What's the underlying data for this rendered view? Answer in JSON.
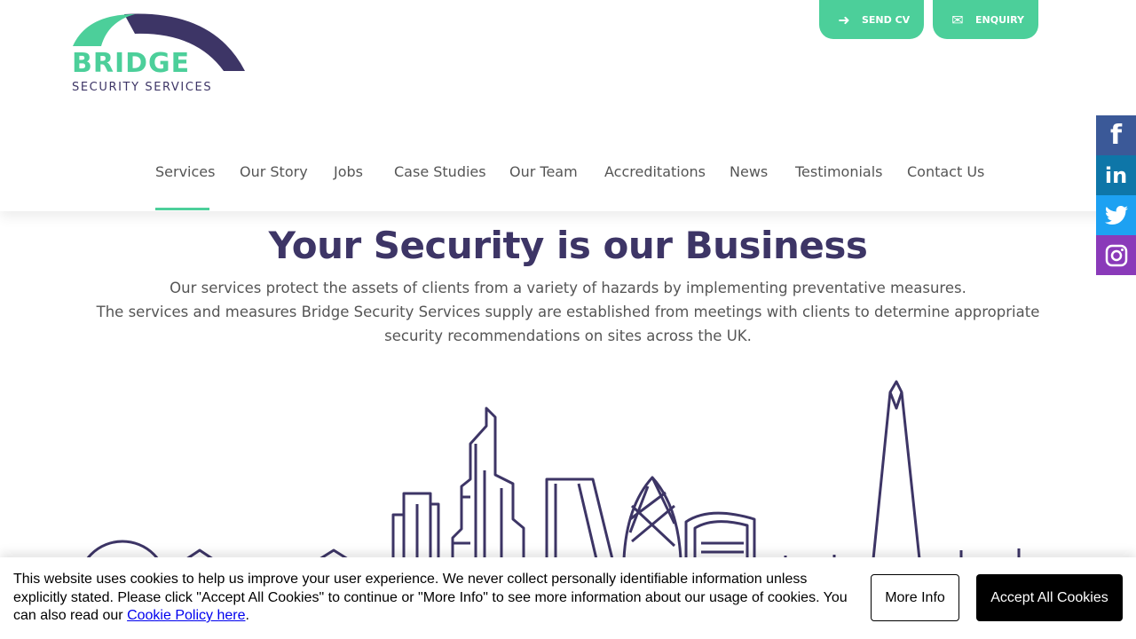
{
  "brand": {
    "name": "BRIDGE",
    "tagline": "SECURITY SERVICES",
    "colors": {
      "green": "#4ccf9a",
      "purple": "#3d3566"
    }
  },
  "top_buttons": {
    "send_cv": {
      "label": "SEND CV",
      "icon": "arrow-right-icon"
    },
    "enquiry": {
      "label": "ENQUIRY",
      "icon": "envelope-icon"
    }
  },
  "nav": {
    "items": [
      {
        "label": "Services",
        "active": true
      },
      {
        "label": "Our Story"
      },
      {
        "label": "Jobs"
      },
      {
        "label": "Case Studies"
      },
      {
        "label": "Our Team"
      },
      {
        "label": "Accreditations"
      },
      {
        "label": "News"
      },
      {
        "label": "Testimonials"
      },
      {
        "label": "Contact Us"
      }
    ]
  },
  "social": {
    "facebook": {
      "glyph": "f",
      "color": "#3b5998",
      "icon": "facebook-icon"
    },
    "linkedin": {
      "glyph": "in",
      "color": "#0e76a8",
      "icon": "linkedin-icon"
    },
    "twitter": {
      "color": "#1da1f2",
      "icon": "twitter-icon"
    },
    "instagram": {
      "color": "#8a3ab9",
      "icon": "instagram-icon"
    }
  },
  "hero": {
    "title": "Your Security is our Business",
    "line1": "Our services protect the assets of clients from a variety of hazards by implementing preventative measures.",
    "line2": "The services and measures Bridge Security Services supply are established from meetings with clients to determine appropriate security recommendations on sites across the UK."
  },
  "cookie": {
    "text_before_link": "This website uses cookies to help us improve your user experience. We never collect personally identifiable information unless explicitly stated. Please click \"Accept All Cookies\" to continue or \"More Info\" to see more information about our usage of cookies. You can also read our ",
    "link_text": "Cookie Policy here",
    "text_after_link": ".",
    "more_info": "More Info",
    "accept_all": "Accept All Cookies"
  }
}
